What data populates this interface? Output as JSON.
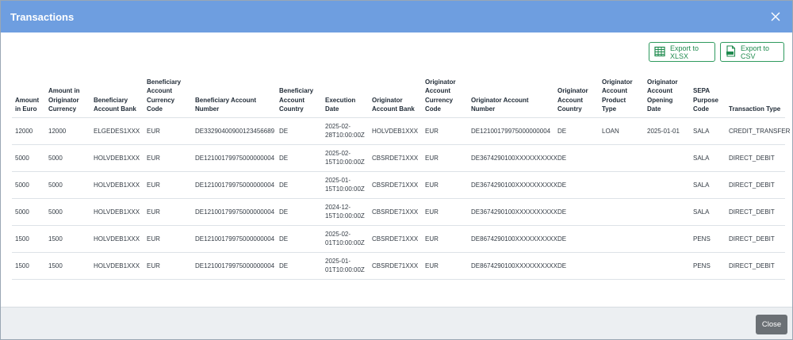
{
  "modal": {
    "title": "Transactions"
  },
  "toolbar": {
    "export_xlsx_label": "Export to XLSX",
    "export_csv_label": "Export to CSV"
  },
  "table": {
    "columns": [
      "Amount in Euro",
      "Amount in Originator Currency",
      "Beneficiary Account Bank",
      "Beneficiary Account Currency Code",
      "Beneficiary Account Number",
      "Beneficiary Account Country",
      "Execution Date",
      "Originator Account Bank",
      "Originator Account Currency Code",
      "Originator Account Number",
      "Originator Account Country",
      "Originator Account Product Type",
      "Originator Account Opening Date",
      "SEPA Purpose Code",
      "Transaction Type"
    ],
    "rows": [
      [
        "12000",
        "12000",
        "ELGEDES1XXX",
        "EUR",
        "DE33290400900123456689",
        "DE",
        "2025-02-28T10:00:00Z",
        "HOLVDEB1XXX",
        "EUR",
        "DE12100179975000000004",
        "DE",
        "LOAN",
        "2025-01-01",
        "SALA",
        "CREDIT_TRANSFER"
      ],
      [
        "5000",
        "5000",
        "HOLVDEB1XXX",
        "EUR",
        "DE12100179975000000004",
        "DE",
        "2025-02-15T10:00:00Z",
        "CBSRDE71XXX",
        "EUR",
        "DE3674290100XXXXXXXXXX",
        "DE",
        "",
        "",
        "SALA",
        "DIRECT_DEBIT"
      ],
      [
        "5000",
        "5000",
        "HOLVDEB1XXX",
        "EUR",
        "DE12100179975000000004",
        "DE",
        "2025-01-15T10:00:00Z",
        "CBSRDE71XXX",
        "EUR",
        "DE3674290100XXXXXXXXXX",
        "DE",
        "",
        "",
        "SALA",
        "DIRECT_DEBIT"
      ],
      [
        "5000",
        "5000",
        "HOLVDEB1XXX",
        "EUR",
        "DE12100179975000000004",
        "DE",
        "2024-12-15T10:00:00Z",
        "CBSRDE71XXX",
        "EUR",
        "DE3674290100XXXXXXXXXX",
        "DE",
        "",
        "",
        "SALA",
        "DIRECT_DEBIT"
      ],
      [
        "1500",
        "1500",
        "HOLVDEB1XXX",
        "EUR",
        "DE12100179975000000004",
        "DE",
        "2025-02-01T10:00:00Z",
        "CBSRDE71XXX",
        "EUR",
        "DE8674290100XXXXXXXXXX",
        "DE",
        "",
        "",
        "PENS",
        "DIRECT_DEBIT"
      ],
      [
        "1500",
        "1500",
        "HOLVDEB1XXX",
        "EUR",
        "DE12100179975000000004",
        "DE",
        "2025-01-01T10:00:00Z",
        "CBSRDE71XXX",
        "EUR",
        "DE8674290100XXXXXXXXXX",
        "DE",
        "",
        "",
        "PENS",
        "DIRECT_DEBIT"
      ]
    ]
  },
  "footer": {
    "close_label": "Close"
  },
  "colors": {
    "header_bg": "#6e9ee0",
    "export_accent": "#2e9a5e",
    "close_button_bg": "#6b7075"
  },
  "icons": {
    "close": "close-icon",
    "xlsx": "spreadsheet-icon",
    "csv": "csv-file-icon"
  }
}
